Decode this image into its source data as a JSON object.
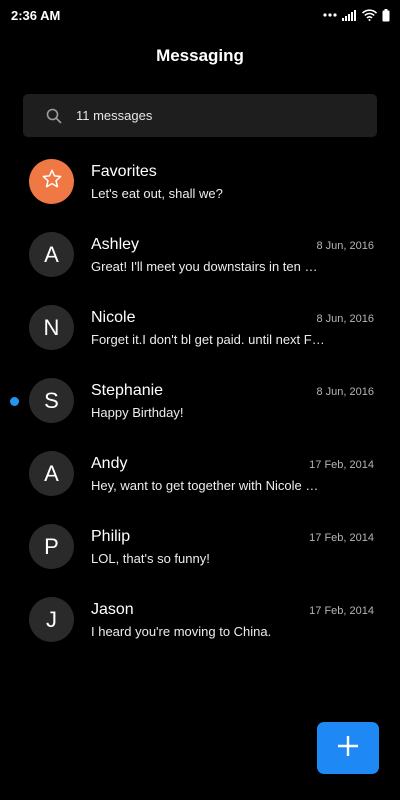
{
  "status_bar": {
    "time": "2:36 AM",
    "icons": [
      "more-dots-icon",
      "signal-icon",
      "wifi-icon",
      "battery-icon"
    ]
  },
  "header": {
    "title": "Messaging"
  },
  "search": {
    "placeholder": "11 messages",
    "icon": "search-icon"
  },
  "conversations": [
    {
      "name": "Favorites",
      "preview": "Let's eat out, shall we?",
      "date": "",
      "avatar": "star-icon",
      "unread": false
    },
    {
      "name": "Ashley",
      "preview": "Great! I'll meet you downstairs in ten …",
      "date": "8 Jun, 2016",
      "avatar": "A",
      "unread": false
    },
    {
      "name": "Nicole",
      "preview": "Forget it.I don't bl get paid. until next F…",
      "date": "8 Jun, 2016",
      "avatar": "N",
      "unread": false
    },
    {
      "name": "Stephanie",
      "preview": "Happy Birthday!",
      "date": "8 Jun, 2016",
      "avatar": "S",
      "unread": true
    },
    {
      "name": "Andy",
      "preview": "Hey, want to get together with Nicole …",
      "date": "17 Feb, 2014",
      "avatar": "A",
      "unread": false
    },
    {
      "name": "Philip",
      "preview": "LOL, that's so funny!",
      "date": "17 Feb, 2014",
      "avatar": "P",
      "unread": false
    },
    {
      "name": "Jason",
      "preview": "I heard you're moving to China.",
      "date": "17 Feb, 2014",
      "avatar": "J",
      "unread": false
    }
  ],
  "fab": {
    "icon": "plus-icon"
  },
  "colors": {
    "background": "#000000",
    "search_bg": "#1e1e1e",
    "avatar_bg": "#2a2a2a",
    "favorites_accent": "#f07845",
    "unread_dot": "#2196f3",
    "fab": "#1e88f5"
  }
}
